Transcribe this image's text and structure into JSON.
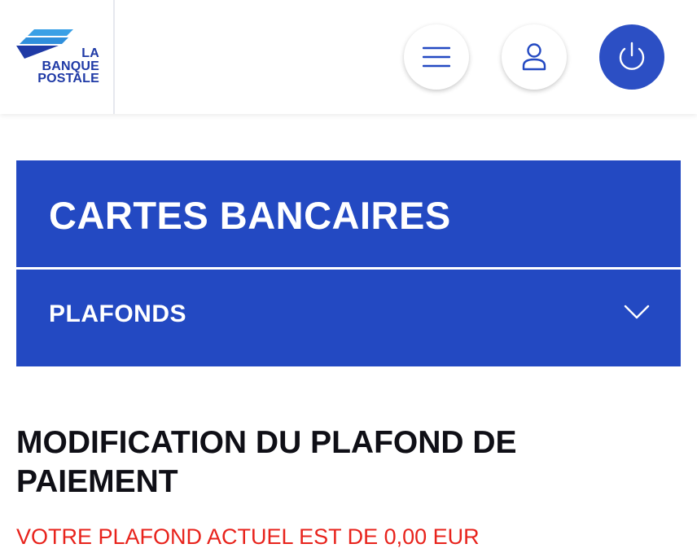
{
  "header": {
    "logo_lines": [
      "LA",
      "BANQUE",
      "POSTALE"
    ],
    "logo_icon": "la-banque-postale-logo",
    "menu_icon": "hamburger-menu-icon",
    "user_icon": "user-icon",
    "power_icon": "power-icon"
  },
  "banner": {
    "title": "CARTES BANCAIRES"
  },
  "accordion": {
    "label": "PLAFONDS",
    "icon": "chevron-down-icon"
  },
  "main": {
    "heading": "MODIFICATION DU PLAFOND DE PAIEMENT",
    "current_limit_text": "VOTRE PLAFOND ACTUEL EST DE 0,00 EUR"
  },
  "colors": {
    "brand_blue": "#2349c2",
    "logo_blue": "#1f3aa6",
    "logo_light_blue": "#3aa0e6",
    "alert_red": "#e8231c",
    "heading_dark": "#0f0f16"
  }
}
